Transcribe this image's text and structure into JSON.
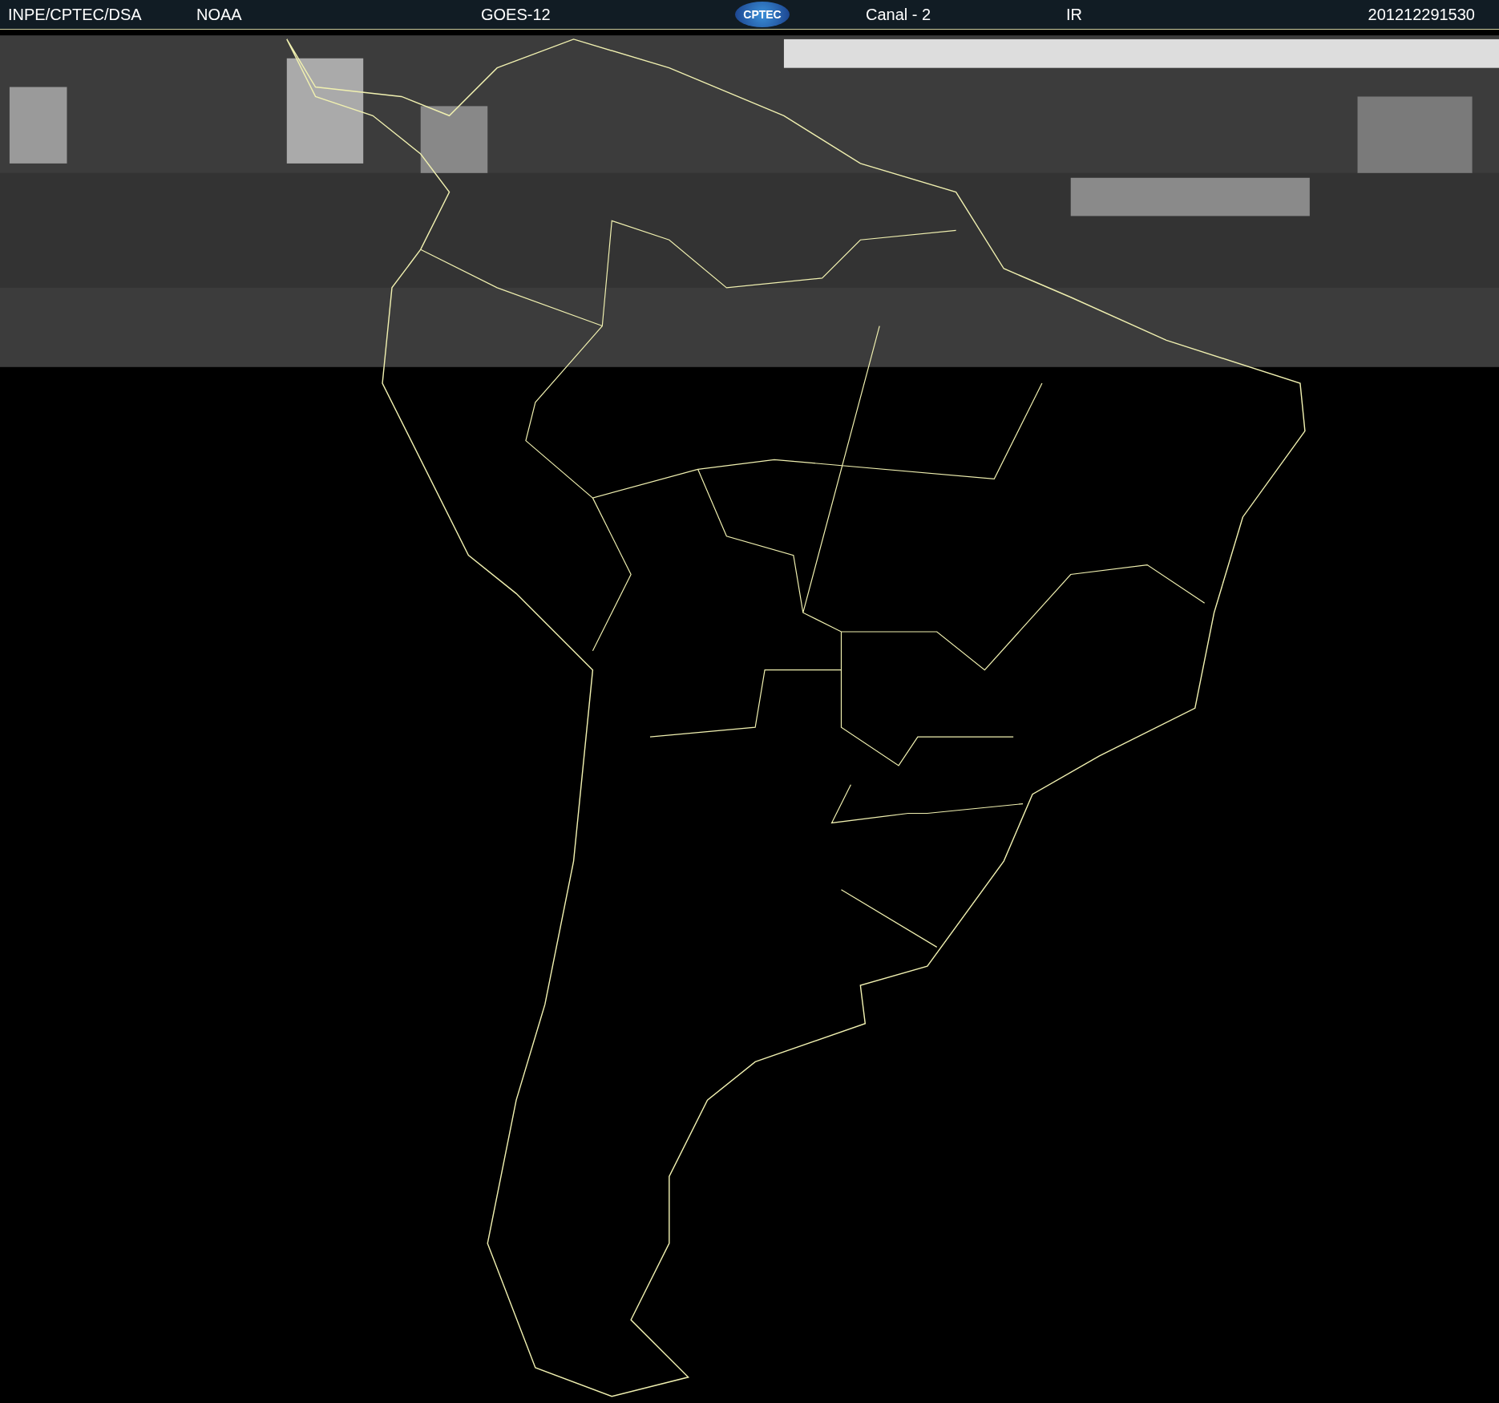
{
  "header": {
    "source": "INPE/CPTEC/DSA",
    "agency": "NOAA",
    "satellite": "GOES-12",
    "logo_text": "CPTEC",
    "channel": "Canal - 2",
    "band": "IR",
    "timestamp": "201212291530"
  }
}
